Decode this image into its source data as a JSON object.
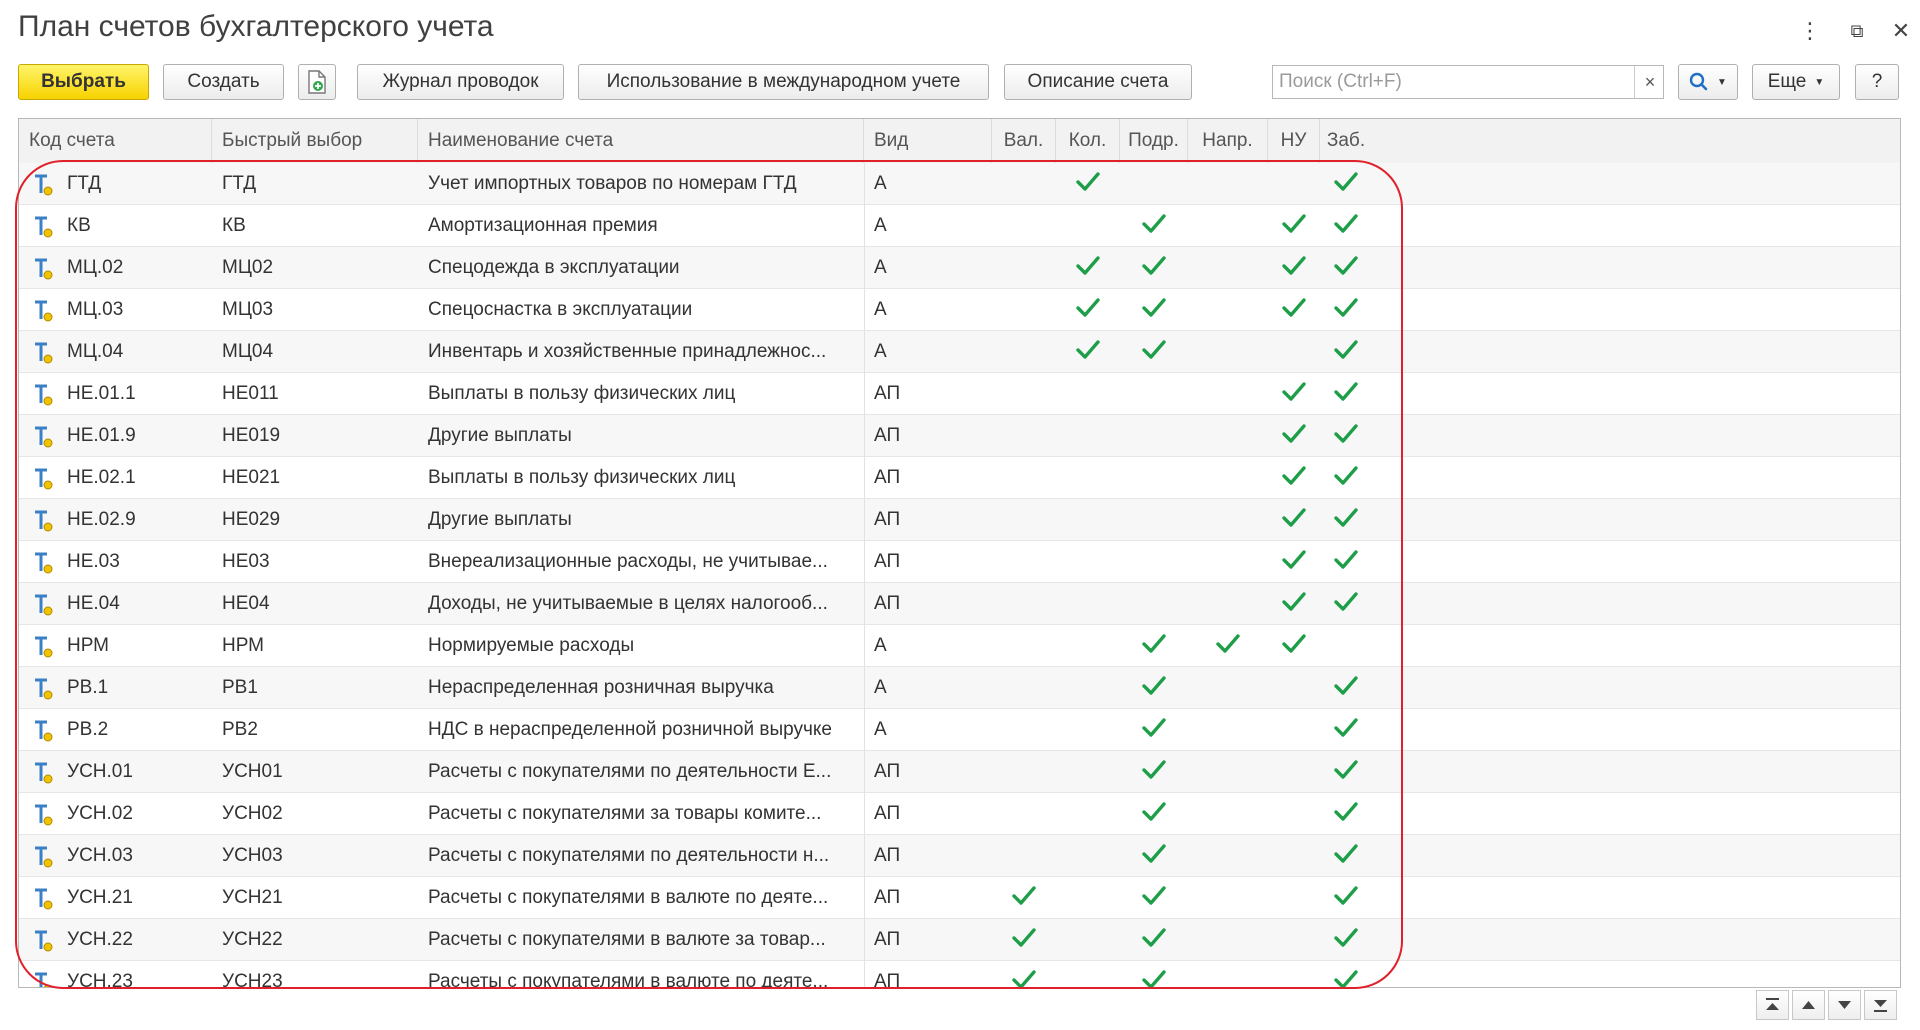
{
  "window": {
    "title": "План счетов бухгалтерского учета",
    "menu_icon": "vertical-dots-icon",
    "restore_icon": "restore-window-icon",
    "close_icon": "close-icon"
  },
  "toolbar": {
    "select_label": "Выбрать",
    "create_label": "Создать",
    "copy_icon": "document-add-icon",
    "journal_label": "Журнал проводок",
    "intl_label": "Использование в международном учете",
    "description_label": "Описание счета",
    "search_placeholder": "Поиск (Ctrl+F)",
    "search_clear": "×",
    "search_icon": "search-icon",
    "more_label": "Еще",
    "help_label": "?"
  },
  "table": {
    "columns": [
      "Код счета",
      "Быстрый выбор",
      "Наименование счета",
      "Вид",
      "Вал.",
      "Кол.",
      "Подр.",
      "Напр.",
      "НУ",
      "Заб."
    ],
    "rows": [
      {
        "code": "ГТД",
        "quick": "ГТД",
        "name": "Учет импортных товаров по номерам ГТД",
        "type": "А",
        "val": false,
        "kol": true,
        "podr": false,
        "napr": false,
        "nu": false,
        "zab": true
      },
      {
        "code": "КВ",
        "quick": "КВ",
        "name": "Амортизационная премия",
        "type": "А",
        "val": false,
        "kol": false,
        "podr": true,
        "napr": false,
        "nu": true,
        "zab": true
      },
      {
        "code": "МЦ.02",
        "quick": "МЦ02",
        "name": "Спецодежда в эксплуатации",
        "type": "А",
        "val": false,
        "kol": true,
        "podr": true,
        "napr": false,
        "nu": true,
        "zab": true
      },
      {
        "code": "МЦ.03",
        "quick": "МЦ03",
        "name": "Спецоснастка в эксплуатации",
        "type": "А",
        "val": false,
        "kol": true,
        "podr": true,
        "napr": false,
        "nu": true,
        "zab": true
      },
      {
        "code": "МЦ.04",
        "quick": "МЦ04",
        "name": "Инвентарь и хозяйственные принадлежнос...",
        "type": "А",
        "val": false,
        "kol": true,
        "podr": true,
        "napr": false,
        "nu": false,
        "zab": true
      },
      {
        "code": "НЕ.01.1",
        "quick": "НЕ011",
        "name": "Выплаты в пользу физических лиц",
        "type": "АП",
        "val": false,
        "kol": false,
        "podr": false,
        "napr": false,
        "nu": true,
        "zab": true
      },
      {
        "code": "НЕ.01.9",
        "quick": "НЕ019",
        "name": "Другие выплаты",
        "type": "АП",
        "val": false,
        "kol": false,
        "podr": false,
        "napr": false,
        "nu": true,
        "zab": true
      },
      {
        "code": "НЕ.02.1",
        "quick": "НЕ021",
        "name": "Выплаты в пользу физических лиц",
        "type": "АП",
        "val": false,
        "kol": false,
        "podr": false,
        "napr": false,
        "nu": true,
        "zab": true
      },
      {
        "code": "НЕ.02.9",
        "quick": "НЕ029",
        "name": "Другие выплаты",
        "type": "АП",
        "val": false,
        "kol": false,
        "podr": false,
        "napr": false,
        "nu": true,
        "zab": true
      },
      {
        "code": "НЕ.03",
        "quick": "НЕ03",
        "name": "Внереализационные расходы, не учитывае...",
        "type": "АП",
        "val": false,
        "kol": false,
        "podr": false,
        "napr": false,
        "nu": true,
        "zab": true
      },
      {
        "code": "НЕ.04",
        "quick": "НЕ04",
        "name": "Доходы, не учитываемые в целях налогооб...",
        "type": "АП",
        "val": false,
        "kol": false,
        "podr": false,
        "napr": false,
        "nu": true,
        "zab": true
      },
      {
        "code": "НРМ",
        "quick": "НРМ",
        "name": "Нормируемые расходы",
        "type": "А",
        "val": false,
        "kol": false,
        "podr": true,
        "napr": true,
        "nu": true,
        "zab": false
      },
      {
        "code": "РВ.1",
        "quick": "РВ1",
        "name": "Нераспределенная розничная выручка",
        "type": "А",
        "val": false,
        "kol": false,
        "podr": true,
        "napr": false,
        "nu": false,
        "zab": true
      },
      {
        "code": "РВ.2",
        "quick": "РВ2",
        "name": "НДС в нераспределенной розничной выручке",
        "type": "А",
        "val": false,
        "kol": false,
        "podr": true,
        "napr": false,
        "nu": false,
        "zab": true
      },
      {
        "code": "УСН.01",
        "quick": "УСН01",
        "name": "Расчеты с покупателями по деятельности Е...",
        "type": "АП",
        "val": false,
        "kol": false,
        "podr": true,
        "napr": false,
        "nu": false,
        "zab": true
      },
      {
        "code": "УСН.02",
        "quick": "УСН02",
        "name": "Расчеты с покупателями за товары комите...",
        "type": "АП",
        "val": false,
        "kol": false,
        "podr": true,
        "napr": false,
        "nu": false,
        "zab": true
      },
      {
        "code": "УСН.03",
        "quick": "УСН03",
        "name": "Расчеты с покупателями по деятельности н...",
        "type": "АП",
        "val": false,
        "kol": false,
        "podr": true,
        "napr": false,
        "nu": false,
        "zab": true
      },
      {
        "code": "УСН.21",
        "quick": "УСН21",
        "name": "Расчеты с покупателями в валюте по деяте...",
        "type": "АП",
        "val": true,
        "kol": false,
        "podr": true,
        "napr": false,
        "nu": false,
        "zab": true
      },
      {
        "code": "УСН.22",
        "quick": "УСН22",
        "name": "Расчеты с покупателями в валюте за товар...",
        "type": "АП",
        "val": true,
        "kol": false,
        "podr": true,
        "napr": false,
        "nu": false,
        "zab": true
      },
      {
        "code": "УСН.23",
        "quick": "УСН23",
        "name": "Расчеты с покупателями в валюте по деяте...",
        "type": "АП",
        "val": true,
        "kol": false,
        "podr": true,
        "napr": false,
        "nu": false,
        "zab": true
      }
    ]
  },
  "navigation": {
    "first_icon": "scroll-to-top-icon",
    "up_icon": "scroll-up-icon",
    "down_icon": "scroll-down-icon",
    "last_icon": "scroll-to-bottom-icon"
  },
  "colors": {
    "primary_button": "#f7d300",
    "check_mark": "#1e9e48",
    "highlight_outline": "#e0202a",
    "account_icon": "#3b7fc4"
  }
}
